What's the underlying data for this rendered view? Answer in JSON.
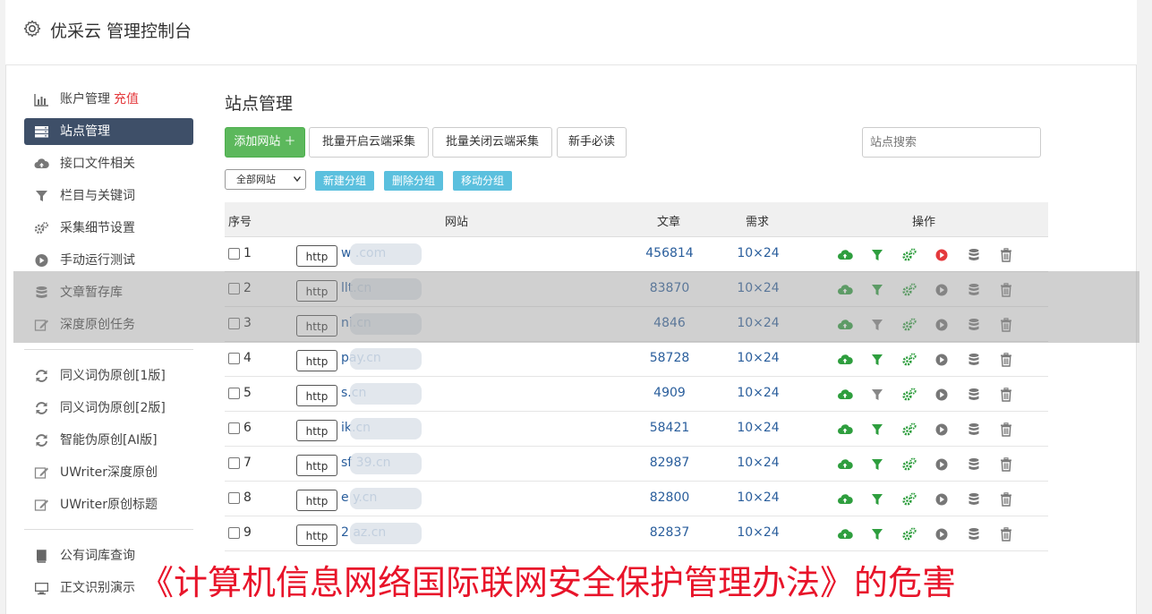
{
  "app": {
    "title": "优采云 管理控制台"
  },
  "sidebar": {
    "items": [
      {
        "label": "账户管理",
        "extra": "充值",
        "icon": "bar-chart-icon"
      },
      {
        "label": "站点管理",
        "icon": "server-icon",
        "active": true
      },
      {
        "label": "接口文件相关",
        "icon": "cloud-upload-icon"
      },
      {
        "label": "栏目与关键词",
        "icon": "filter-icon"
      },
      {
        "label": "采集细节设置",
        "icon": "cogs-icon"
      },
      {
        "label": "手动运行测试",
        "icon": "play-icon"
      },
      {
        "label": "文章暂存库",
        "icon": "database-icon"
      },
      {
        "label": "深度原创任务",
        "icon": "edit-icon"
      }
    ],
    "items2": [
      {
        "label": "同义词伪原创[1版]",
        "icon": "refresh-icon"
      },
      {
        "label": "同义词伪原创[2版]",
        "icon": "refresh-icon"
      },
      {
        "label": "智能伪原创[AI版]",
        "icon": "refresh-icon"
      },
      {
        "label": "UWriter深度原创",
        "icon": "edit-icon"
      },
      {
        "label": "UWriter原创标题",
        "icon": "edit-icon"
      }
    ],
    "items3": [
      {
        "label": "公有词库查询",
        "icon": "book-icon"
      },
      {
        "label": "正文识别演示",
        "icon": "monitor-icon"
      }
    ]
  },
  "main": {
    "title": "站点管理",
    "toolbar": {
      "add_label": "添加网站 ＋",
      "batch_on_label": "批量开启云端采集",
      "batch_off_label": "批量关闭云端采集",
      "newbie_label": "新手必读",
      "search_placeholder": "站点搜索"
    },
    "groups": {
      "select_value": "全部网站",
      "new_group": "新建分组",
      "delete_group": "删除分组",
      "move_group": "移动分组"
    },
    "table": {
      "headers": {
        "seq": "序号",
        "site": "网站",
        "articles": "文章",
        "demand": "需求",
        "ops": "操作"
      },
      "rows": [
        {
          "num": "1",
          "protocol": "http",
          "domain": "w                  .com",
          "articles": "456814",
          "demand": "10×24",
          "filter_on": true,
          "play_on": true
        },
        {
          "num": "2",
          "protocol": "http",
          "domain": "     llt.cn",
          "articles": "83870",
          "demand": "10×24",
          "filter_on": true,
          "play_on": false
        },
        {
          "num": "3",
          "protocol": "http",
          "domain": "     ni.cn",
          "articles": "4846",
          "demand": "10×24",
          "filter_on": false,
          "play_on": false
        },
        {
          "num": "4",
          "protocol": "http",
          "domain": "      pay.cn",
          "articles": "58728",
          "demand": "10×24",
          "filter_on": true,
          "play_on": false
        },
        {
          "num": "5",
          "protocol": "http",
          "domain": "      s.cn",
          "articles": "4909",
          "demand": "10×24",
          "filter_on": false,
          "play_on": false
        },
        {
          "num": "6",
          "protocol": "http",
          "domain": "     ik.cn",
          "articles": "58421",
          "demand": "10×24",
          "filter_on": true,
          "play_on": false
        },
        {
          "num": "7",
          "protocol": "http",
          "domain": "sf  39.cn",
          "articles": "82987",
          "demand": "10×24",
          "filter_on": true,
          "play_on": false
        },
        {
          "num": "8",
          "protocol": "http",
          "domain": "e      y.cn",
          "articles": "82800",
          "demand": "10×24",
          "filter_on": true,
          "play_on": false
        },
        {
          "num": "9",
          "protocol": "http",
          "domain": "2     az.cn",
          "articles": "82837",
          "demand": "10×24",
          "filter_on": true,
          "play_on": false
        }
      ]
    }
  },
  "caption": "《计算机信息网络国际联网安全保护管理办法》的危害",
  "colors": {
    "sidebar_active": "#3e4f68",
    "add_button": "#5cb85c",
    "group_button": "#5bc0de",
    "link": "#2a5e9c",
    "caption": "#e8142a",
    "op_green": "#2e9e3e",
    "op_red": "#e4393c"
  }
}
